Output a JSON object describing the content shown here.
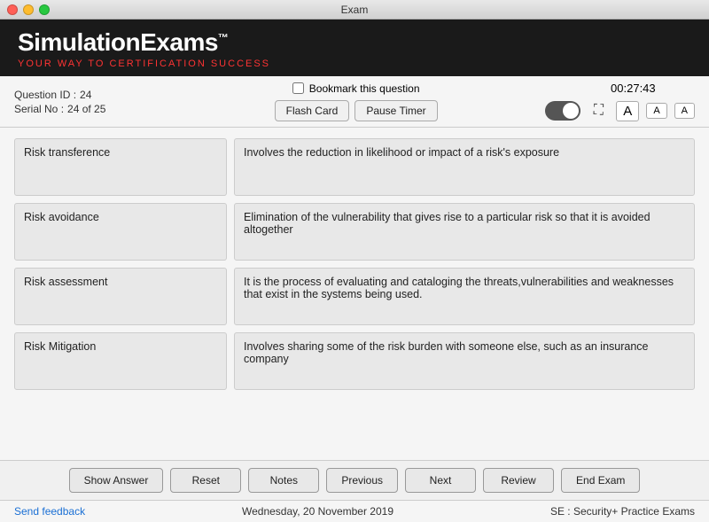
{
  "titleBar": {
    "title": "Exam"
  },
  "header": {
    "logoText": "SimulationExams",
    "logoTM": "™",
    "subtitle": "YOUR WAY TO CERTIFICATION ",
    "subtitleHighlight": "SUCCESS"
  },
  "infoBar": {
    "questionIdLabel": "Question ID :",
    "questionIdValue": "24",
    "serialNoLabel": "Serial No :",
    "serialNoValue": "24 of 25",
    "bookmarkLabel": "Bookmark this question",
    "flashCardLabel": "Flash Card",
    "pauseTimerLabel": "Pause Timer",
    "timer": "00:27:43",
    "fontBtnA1": "A",
    "fontBtnA2": "A",
    "fontBtnA3": "A"
  },
  "flashCards": [
    {
      "left": "Risk transference",
      "right": "Involves the reduction in likelihood or impact of a risk's exposure"
    },
    {
      "left": "Risk avoidance",
      "right": "Elimination of the vulnerability that gives rise to a particular risk so that it is avoided altogether"
    },
    {
      "left": "Risk assessment",
      "right": "It is the process of evaluating and cataloging the threats,vulnerabilities and weaknesses that exist in the systems being used."
    },
    {
      "left": "Risk Mitigation",
      "right": "Involves sharing some of the risk burden with someone else, such as an insurance company"
    }
  ],
  "toolbar": {
    "showAnswer": "Show Answer",
    "reset": "Reset",
    "notes": "Notes",
    "previous": "Previous",
    "next": "Next",
    "review": "Review",
    "endExam": "End Exam"
  },
  "statusBar": {
    "feedbackLink": "Send feedback",
    "date": "Wednesday, 20 November 2019",
    "examTitle": "SE : Security+ Practice Exams"
  }
}
